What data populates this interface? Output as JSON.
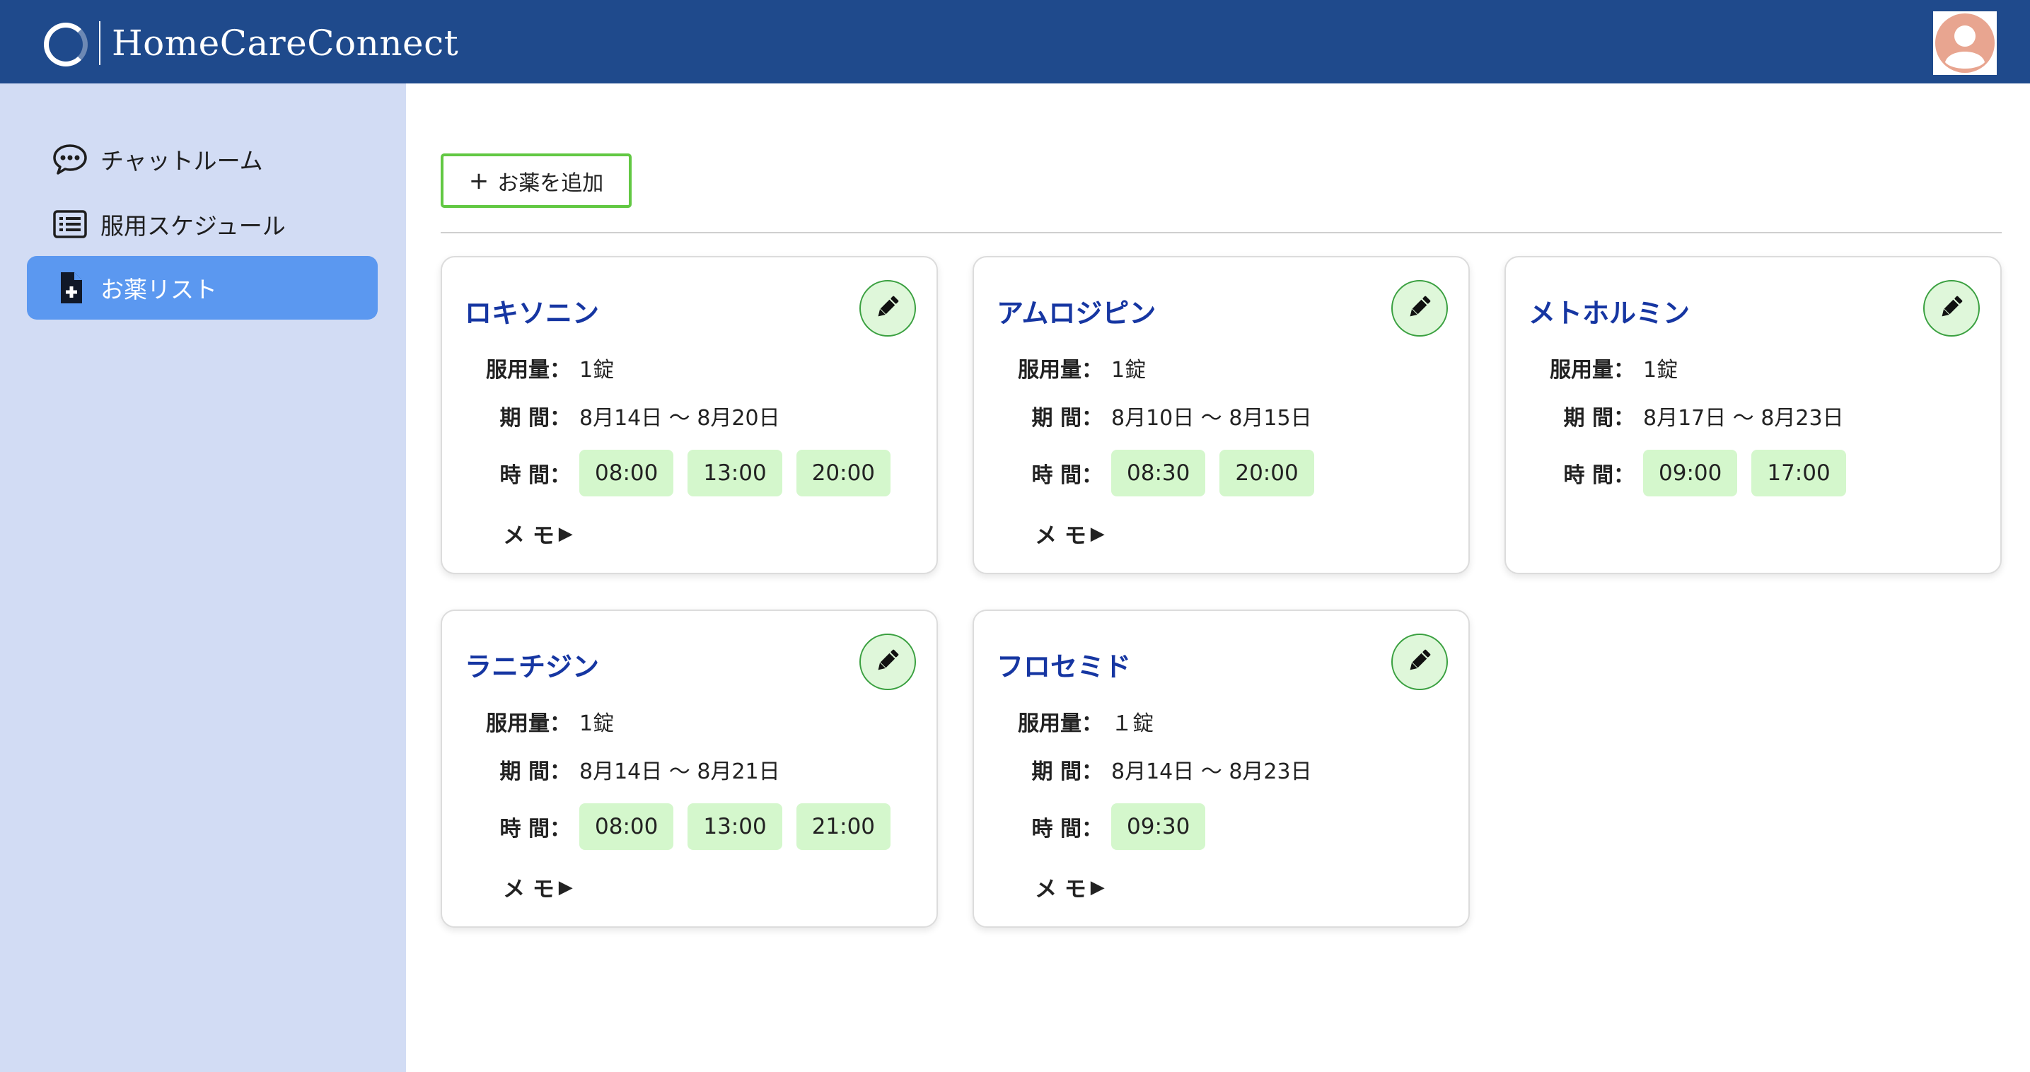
{
  "header": {
    "brand": "HomeCareConnect",
    "logo": "circle-logo-icon",
    "avatar": "user-avatar-icon"
  },
  "sidebar": {
    "items": [
      {
        "label": "チャットルーム",
        "icon": "chat-bubble-icon",
        "active": false
      },
      {
        "label": "服用スケジュール",
        "icon": "list-icon",
        "active": false
      },
      {
        "label": "お薬リスト",
        "icon": "medical-file-icon",
        "active": true
      }
    ]
  },
  "main": {
    "add_button": {
      "plus": "+",
      "label": "お薬を追加"
    },
    "labels": {
      "dose": "服用量：",
      "period": "期 間：",
      "time": "時 間：",
      "memo": "メ モ",
      "memo_arrow": "▶"
    },
    "medications": [
      {
        "name": "ロキソニン",
        "dose": "1錠",
        "period": "8月14日 〜 8月20日",
        "times": [
          "08:00",
          "13:00",
          "20:00"
        ],
        "has_memo": true
      },
      {
        "name": "アムロジピン",
        "dose": "1錠",
        "period": "8月10日 〜 8月15日",
        "times": [
          "08:30",
          "20:00"
        ],
        "has_memo": true
      },
      {
        "name": "メトホルミン",
        "dose": "1錠",
        "period": "8月17日 〜 8月23日",
        "times": [
          "09:00",
          "17:00"
        ],
        "has_memo": false
      },
      {
        "name": "ラニチジン",
        "dose": "1錠",
        "period": "8月14日 〜 8月21日",
        "times": [
          "08:00",
          "13:00",
          "21:00"
        ],
        "has_memo": true
      },
      {
        "name": "フロセミド",
        "dose": "１錠",
        "period": "8月14日 〜 8月23日",
        "times": [
          "09:30"
        ],
        "has_memo": true
      }
    ]
  },
  "colors": {
    "header": "#1f4a8c",
    "sidebar": "#d2dcf4",
    "active_nav": "#5b98f0",
    "accent_green": "#62c843",
    "title_blue": "#1636a2",
    "chip": "#d4f7cc"
  }
}
